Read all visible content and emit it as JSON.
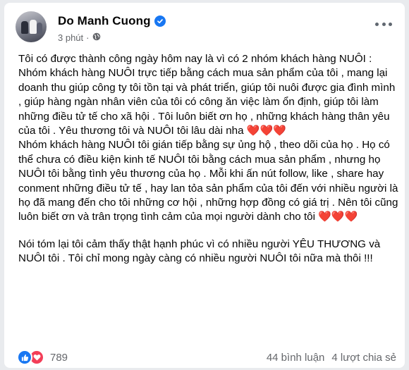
{
  "post": {
    "author": "Do Manh Cuong",
    "time": "3 phút",
    "separator": "·",
    "paragraphs": [
      "Tôi có được thành công ngày hôm nay là vì có 2 nhóm khách hàng NUÔI :",
      "Nhóm khách hàng NUÔI trực tiếp bằng cách mua sản phẩm của tôi , mang lại doanh thu giúp công ty tôi tồn tại và phát triển, giúp tôi nuôi được gia đình mình , giúp hàng ngàn nhân viên của tôi có công ăn việc làm ổn định, giúp tôi làm những điều tử tế cho xã hội . Tôi luôn biết ơn họ , những khách hàng thân yêu của tôi . Yêu thương tôi và NUÔI tôi lâu dài nha",
      "Nhóm khách hàng NUÔI tôi gián tiếp bằng sự ủng hộ , theo dõi của họ . Họ có thể chưa có điều kiện kinh tế NUÔI tôi bằng cách mua sản phẩm , nhưng họ NUÔI tôi bằng tình yêu thương của họ . Mỗi khi ấn nút follow, like , share hay conment những điều tử tế , hay lan tỏa sản phẩm của tôi đến với nhiều người là họ đã mang đến cho tôi những cơ hội , những hợp đồng có giá trị . Nên tôi cũng luôn biết ơn và trân trọng tình cảm của mọi người dành cho tôi",
      "Nói tóm lại tôi cảm thấy thật hạnh phúc vì có nhiều người YÊU THƯƠNG và NUÔI tôi . Tôi chỉ mong ngày càng có nhiều người NUÔI tôi nữa mà thôi !!!"
    ],
    "hearts": "❤️❤️❤️",
    "reaction_count": "789",
    "comments": "44 bình luận",
    "shares": "4 lượt chia sẻ"
  },
  "icons": {
    "verified": "verified-check-icon",
    "privacy": "globe-icon",
    "more": "more-options-icon",
    "like": "like-reaction-icon",
    "love": "love-reaction-icon"
  },
  "colors": {
    "facebook_blue": "#1877f2",
    "love_red": "#f33e58",
    "text": "#050505",
    "secondary": "#65676b"
  }
}
